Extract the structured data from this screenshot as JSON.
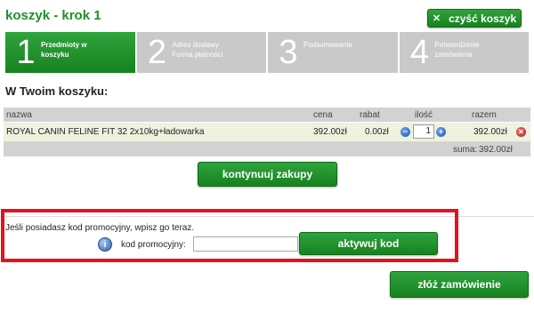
{
  "header": {
    "title": "koszyk - krok 1",
    "clear_label": "czyść koszyk"
  },
  "steps": [
    {
      "num": "1",
      "line1": "Przedmioty w",
      "line2": "koszyku"
    },
    {
      "num": "2",
      "line1": "Adres dostawy",
      "line2": "Forma płatności"
    },
    {
      "num": "3",
      "line1": "Podsumowanie",
      "line2": ""
    },
    {
      "num": "4",
      "line1": "Potwierdzenie",
      "line2": "zamówienia"
    }
  ],
  "cart": {
    "title": "W Twoim koszyku:",
    "columns": {
      "name": "nazwa",
      "price": "cena",
      "discount": "rabat",
      "qty": "ilość",
      "total": "razem"
    },
    "items": [
      {
        "name": "ROYAL CANIN FELINE FIT 32 2x10kg+ładowarka",
        "price": "392.00zł",
        "discount": "0.00zł",
        "qty": "1",
        "total": "392.00zł"
      }
    ],
    "sum_label": "suma:",
    "sum_value": "392.00zł"
  },
  "continue_label": "kontynuuj zakupy",
  "promo": {
    "info": "Jeśli posiadasz kod promocyjny, wpisz go teraz.",
    "label": "kod promocyjny:",
    "value": "",
    "button": "aktywuj kod"
  },
  "order_label": "złóż zamówienie",
  "colors": {
    "brand_green": "#1e8f2a",
    "highlight_red": "#e0131f"
  },
  "icons": {
    "clear": "x-icon",
    "minus": "minus-icon",
    "plus": "plus-icon",
    "remove": "remove-icon",
    "info": "info-icon"
  }
}
